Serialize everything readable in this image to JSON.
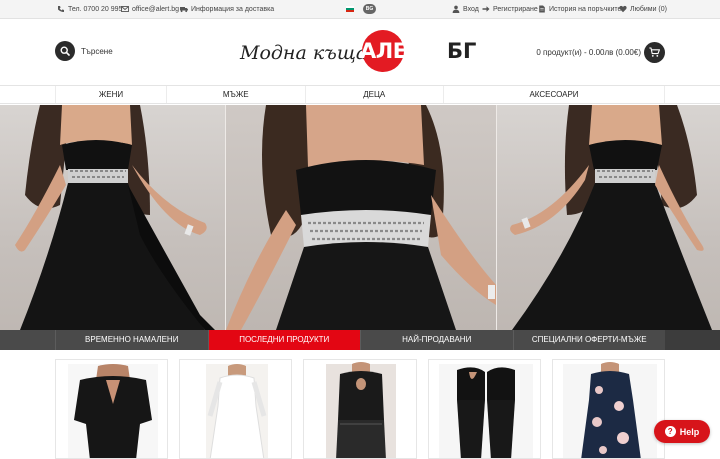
{
  "topbar": {
    "phone": "Тел. 0700 20 995",
    "email": "office@alert.bg",
    "delivery": "Информация за доставка",
    "language": "BG",
    "login": "Вход",
    "register": "Регистриране",
    "order_history": "История на поръчките",
    "favorites": "Любими (0)"
  },
  "header": {
    "search_label": "Търсене",
    "logo_script": "Модна къща",
    "logo_alert": "АЛЕРТ",
    "logo_bg": "БГ",
    "cart_summary": "0 продукт(и) - 0.00лв (0.00€)"
  },
  "nav": {
    "items": [
      "ЖЕНИ",
      "МЪЖЕ",
      "ДЕЦА",
      "АКСЕСОАРИ"
    ]
  },
  "hero_tabs": {
    "items": [
      "ВРЕМЕННО НАМАЛЕНИ",
      "ПОСЛЕДНИ ПРОДУКТИ",
      "НАЙ-ПРОДАВАНИ",
      "СПЕЦИАЛНИ ОФЕРТИ-МЪЖЕ"
    ],
    "active_index": 1
  },
  "help": {
    "label": "Help"
  },
  "colors": {
    "accent": "#e30613",
    "dark": "#2b2b2b",
    "tab_bar": "#4a4a4a"
  }
}
